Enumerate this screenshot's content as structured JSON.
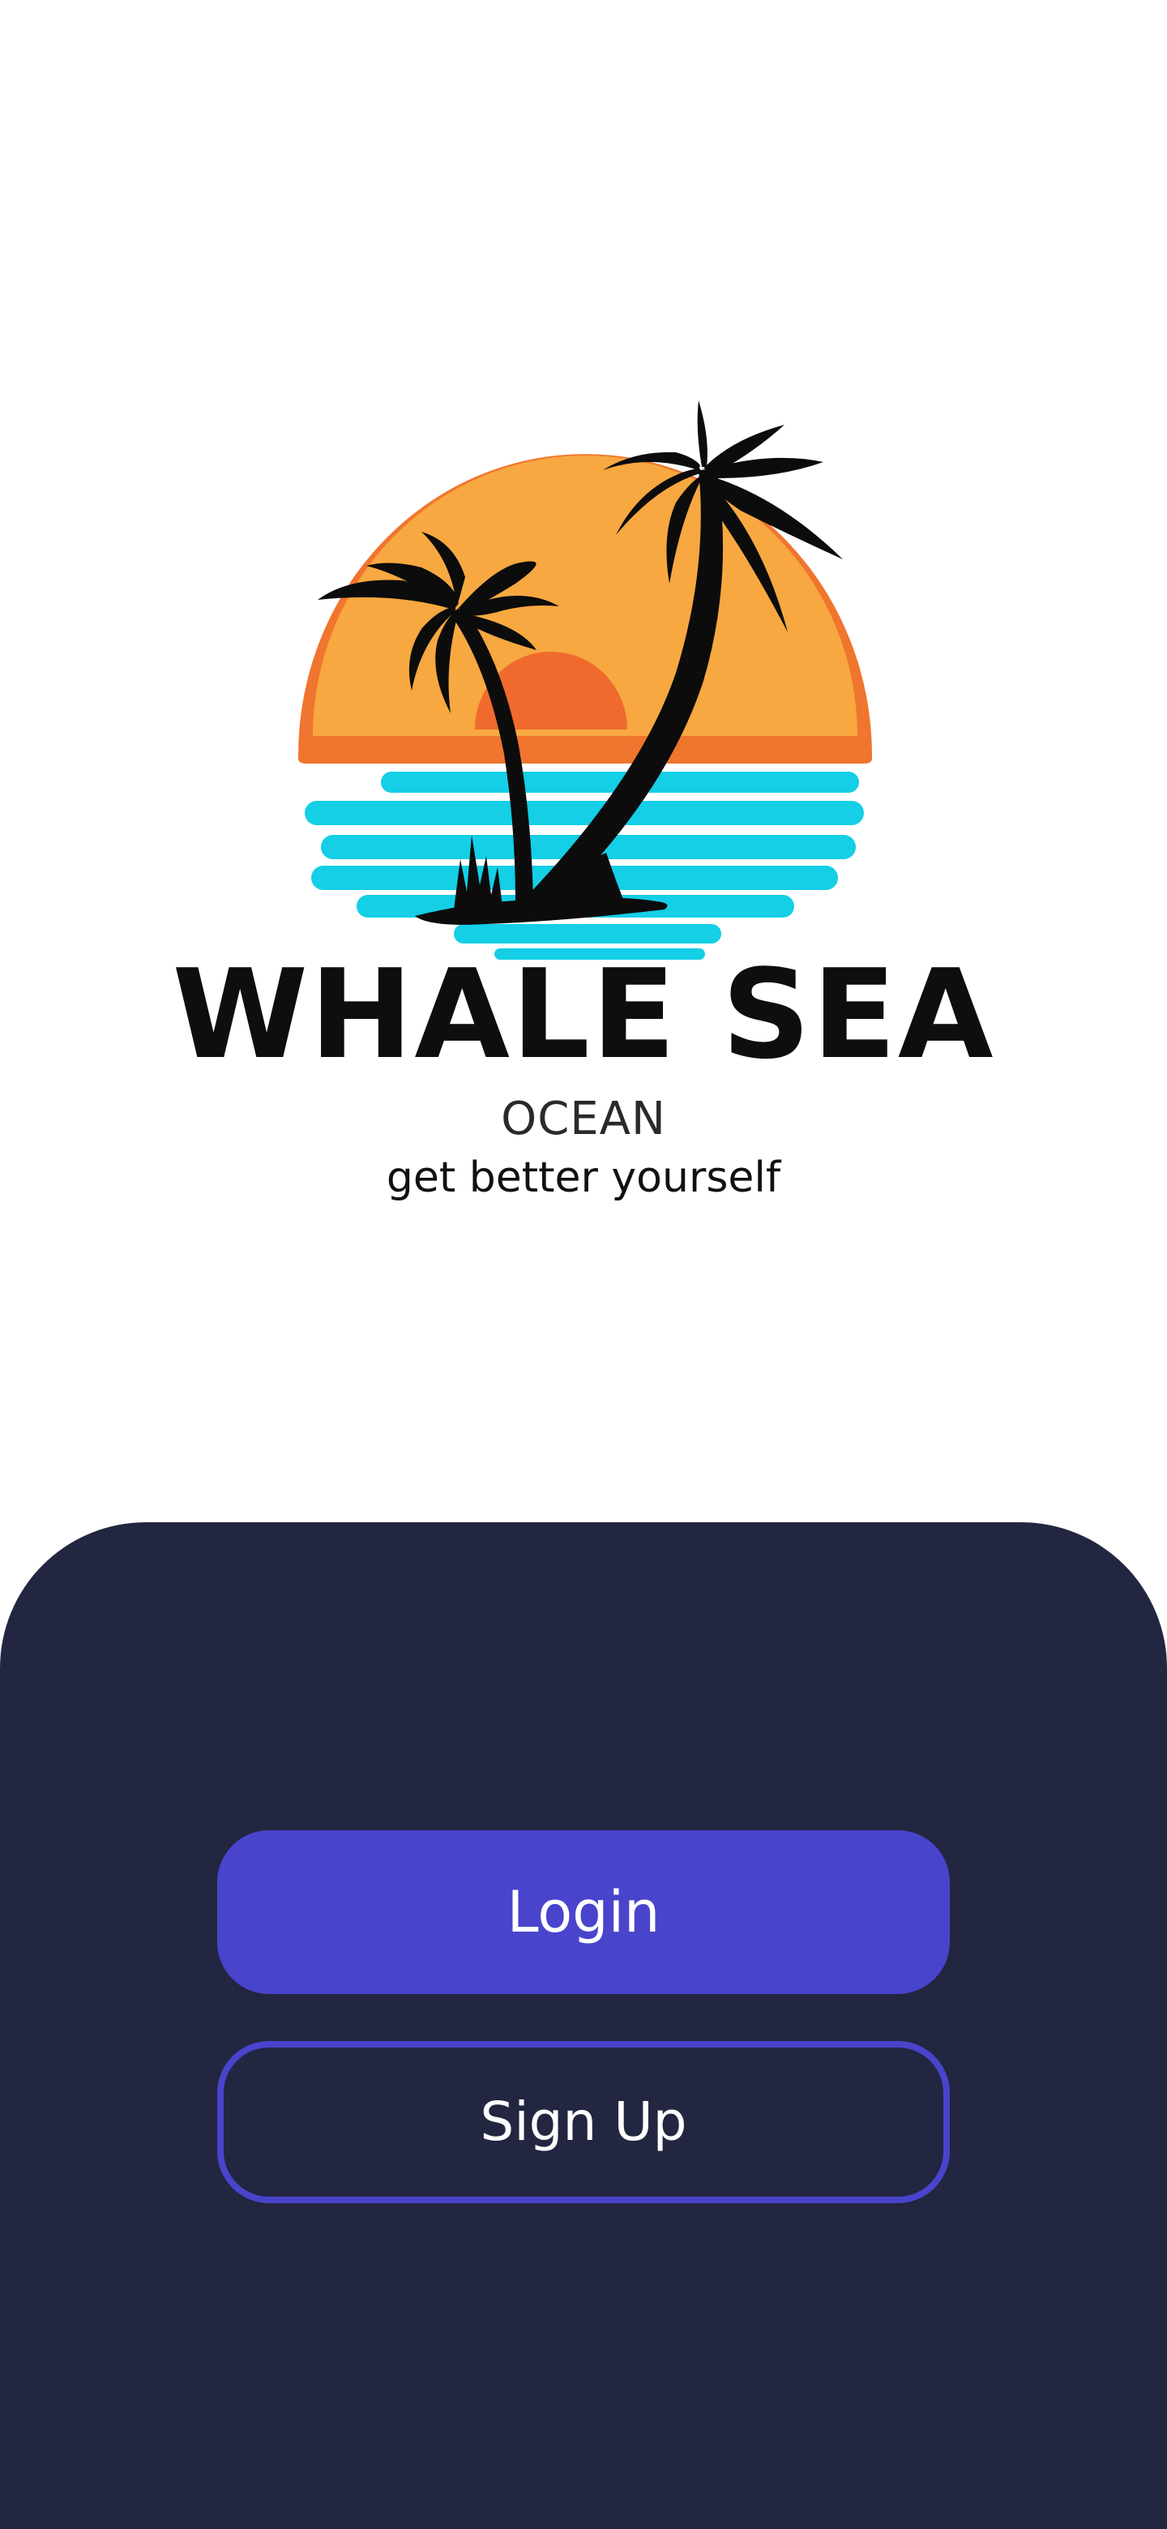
{
  "brand": {
    "title": "WHALE SEA",
    "subtitle": "OCEAN",
    "tagline": "get better yourself",
    "logo_icon": "palm-sunset-logo"
  },
  "actions": {
    "login_label": "Login",
    "signup_label": "Sign Up"
  },
  "colors": {
    "panel_background": "#222640",
    "accent": "#4944cc",
    "sun_outer": "#f0752e",
    "sun_inner": "#f7a840",
    "sea": "#14cfe6",
    "silhouette": "#0c0c0c"
  }
}
